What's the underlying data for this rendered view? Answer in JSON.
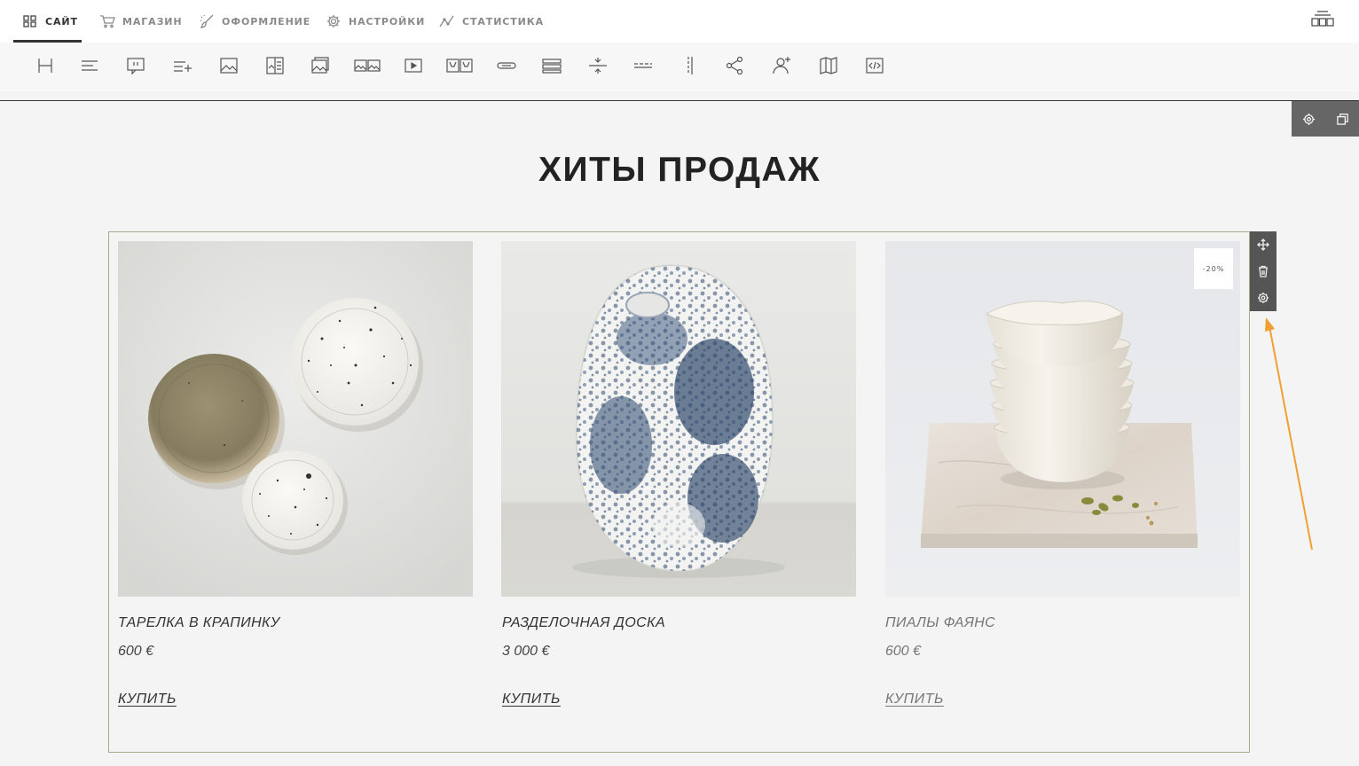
{
  "nav": {
    "tabs": [
      {
        "label": "САЙТ",
        "icon": "grid-icon",
        "active": true
      },
      {
        "label": "МАГАЗИН",
        "icon": "cart-icon"
      },
      {
        "label": "ОФОРМЛЕНИЕ",
        "icon": "brush-icon"
      },
      {
        "label": "НАСТРОЙКИ",
        "icon": "gear-icon"
      },
      {
        "label": "СТАТИСТИКА",
        "icon": "chart-icon"
      }
    ]
  },
  "toolbar": {
    "tools": [
      "heading-icon",
      "text-icon",
      "quote-icon",
      "list-icon",
      "image-icon",
      "image-text-icon",
      "gallery-icon",
      "carousel-icon",
      "video-icon",
      "products-icon",
      "button-icon",
      "form-icon",
      "spacer-icon",
      "divider-icon",
      "columns-icon",
      "share-icon",
      "team-icon",
      "map-icon",
      "code-icon"
    ]
  },
  "section": {
    "title": "ХИТЫ ПРОДАЖ"
  },
  "products": [
    {
      "name": "ТАРЕЛКА В КРАПИНКУ",
      "price": "600 €",
      "buy_label": "КУПИТЬ"
    },
    {
      "name": "РАЗДЕЛОЧНАЯ ДОСКА",
      "price": "3 000 €",
      "buy_label": "КУПИТЬ"
    },
    {
      "name": "ПИАЛЫ ФАЯНС",
      "price": "600 €",
      "buy_label": "КУПИТЬ",
      "badge": "-20%"
    }
  ],
  "colors": {
    "accent_arrow": "#f0a030",
    "frame_border": "#a8a890",
    "control_bg": "#555555"
  }
}
